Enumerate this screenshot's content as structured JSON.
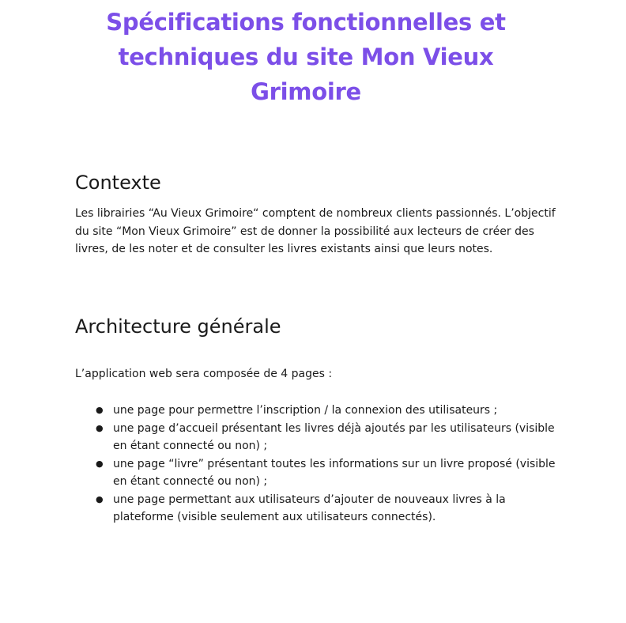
{
  "document": {
    "title": "Spécifications fonctionnelles et techniques du site Mon Vieux Grimoire",
    "sections": [
      {
        "heading": "Contexte",
        "paragraph": "Les librairies “Au Vieux Grimoire“ comptent de nombreux clients passionnés. L’objectif du site “Mon Vieux Grimoire” est de donner la possibilité aux lecteurs de créer des livres, de les noter et de consulter les livres existants ainsi que leurs notes."
      },
      {
        "heading": "Architecture générale",
        "intro": "L’application web sera composée de 4 pages :",
        "list_items": [
          "une page pour permettre l’inscription / la connexion des utilisateurs ;",
          "une page d’accueil présentant les livres déjà ajoutés par les utilisateurs (visible en étant connecté ou non) ;",
          "une page “livre” présentant toutes les informations sur un livre proposé (visible en étant connecté ou non) ;",
          "une page permettant aux utilisateurs d’ajouter de nouveaux livres à la plateforme (visible seulement aux utilisateurs connectés)."
        ]
      }
    ]
  },
  "colors": {
    "title": "#7c4fe8",
    "text": "#1a1a1a"
  }
}
